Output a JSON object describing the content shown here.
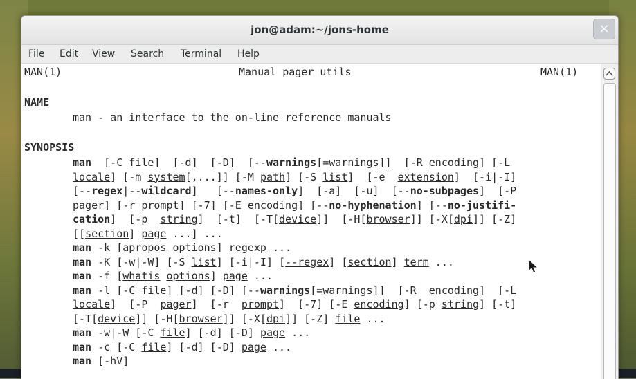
{
  "window": {
    "title": "jon@adam:~/jons-home",
    "close_glyph": "×"
  },
  "menu": [
    "File",
    "Edit",
    "View",
    "Search",
    "Terminal",
    "Help"
  ],
  "manpage": {
    "header_left": "MAN(1)",
    "header_center": "Manual pager utils",
    "header_right": "MAN(1)",
    "name_heading": "NAME",
    "name_desc": "man - an interface to the on-line reference manuals",
    "synopsis_heading": "SYNOPSIS",
    "synopsis_lines": [
      [
        {
          "t": "man",
          "b": 1
        },
        {
          "t": "  [-C "
        },
        {
          "t": "file",
          "u": 1
        },
        {
          "t": "]  [-d]  [-D]  [--"
        },
        {
          "t": "warnings",
          "b": 1
        },
        {
          "t": "[="
        },
        {
          "t": "warnings",
          "u": 1
        },
        {
          "t": "]]  [-R "
        },
        {
          "t": "encoding",
          "u": 1
        },
        {
          "t": "] [-L"
        }
      ],
      [
        {
          "t": "locale",
          "u": 1
        },
        {
          "t": "] [-m "
        },
        {
          "t": "system",
          "u": 1
        },
        {
          "t": "[,...]] [-M "
        },
        {
          "t": "path",
          "u": 1
        },
        {
          "t": "] [-S "
        },
        {
          "t": "list",
          "u": 1
        },
        {
          "t": "]  [-e  "
        },
        {
          "t": "extension",
          "u": 1
        },
        {
          "t": "]  [-i|-I]"
        }
      ],
      [
        {
          "t": "[--"
        },
        {
          "t": "regex",
          "b": 1
        },
        {
          "t": "|--"
        },
        {
          "t": "wildcard",
          "b": 1
        },
        {
          "t": "]   [--"
        },
        {
          "t": "names-only",
          "b": 1
        },
        {
          "t": "]  [-a]  [-u]  [--"
        },
        {
          "t": "no-subpages",
          "b": 1
        },
        {
          "t": "]  [-P"
        }
      ],
      [
        {
          "t": "pager",
          "u": 1
        },
        {
          "t": "] [-r "
        },
        {
          "t": "prompt",
          "u": 1
        },
        {
          "t": "] [-7] [-E "
        },
        {
          "t": "encoding",
          "u": 1
        },
        {
          "t": "] [--"
        },
        {
          "t": "no-hyphenation",
          "b": 1
        },
        {
          "t": "] [--"
        },
        {
          "t": "no-justifi-",
          "b": 1
        }
      ],
      [
        {
          "t": "cation",
          "b": 1
        },
        {
          "t": "]  [-p  "
        },
        {
          "t": "string",
          "u": 1
        },
        {
          "t": "]  [-t]  [-T["
        },
        {
          "t": "device",
          "u": 1
        },
        {
          "t": "]]  [-H["
        },
        {
          "t": "browser",
          "u": 1
        },
        {
          "t": "]] [-X["
        },
        {
          "t": "dpi",
          "u": 1
        },
        {
          "t": "]] [-Z]"
        }
      ],
      [
        {
          "t": "[["
        },
        {
          "t": "section",
          "u": 1
        },
        {
          "t": "] "
        },
        {
          "t": "page",
          "u": 1
        },
        {
          "t": " ...] ..."
        }
      ],
      [
        {
          "t": "man",
          "b": 1
        },
        {
          "t": " -k [",
          "b": 0
        },
        {
          "t": "apropos",
          "u": 1
        },
        {
          "t": " "
        },
        {
          "t": "options",
          "u": 1
        },
        {
          "t": "] "
        },
        {
          "t": "regexp",
          "u": 1
        },
        {
          "t": " ..."
        }
      ],
      [
        {
          "t": "man",
          "b": 1
        },
        {
          "t": " -K [-w|-W] [-S "
        },
        {
          "t": "list",
          "u": 1
        },
        {
          "t": "] [-i|-I] ["
        },
        {
          "t": "--regex",
          "u": 1
        },
        {
          "t": "] ["
        },
        {
          "t": "section",
          "u": 1
        },
        {
          "t": "] "
        },
        {
          "t": "term",
          "u": 1
        },
        {
          "t": " ..."
        }
      ],
      [
        {
          "t": "man",
          "b": 1
        },
        {
          "t": " -f ["
        },
        {
          "t": "whatis",
          "u": 1
        },
        {
          "t": " "
        },
        {
          "t": "options",
          "u": 1
        },
        {
          "t": "] "
        },
        {
          "t": "page",
          "u": 1
        },
        {
          "t": " ..."
        }
      ],
      [
        {
          "t": "man",
          "b": 1
        },
        {
          "t": " -l [-C "
        },
        {
          "t": "file",
          "u": 1
        },
        {
          "t": "] [-d] [-D] [--"
        },
        {
          "t": "warnings",
          "b": 1
        },
        {
          "t": "[="
        },
        {
          "t": "warnings",
          "u": 1
        },
        {
          "t": "]]  [-R  "
        },
        {
          "t": "encoding",
          "u": 1
        },
        {
          "t": "]  [-L"
        }
      ],
      [
        {
          "t": "locale",
          "u": 1
        },
        {
          "t": "]  [-P  "
        },
        {
          "t": "pager",
          "u": 1
        },
        {
          "t": "]  [-r  "
        },
        {
          "t": "prompt",
          "u": 1
        },
        {
          "t": "]  [-7] [-E "
        },
        {
          "t": "encoding",
          "u": 1
        },
        {
          "t": "] [-p "
        },
        {
          "t": "string",
          "u": 1
        },
        {
          "t": "] [-t]"
        }
      ],
      [
        {
          "t": "[-T["
        },
        {
          "t": "device",
          "u": 1
        },
        {
          "t": "]] [-H["
        },
        {
          "t": "browser",
          "u": 1
        },
        {
          "t": "]] [-X["
        },
        {
          "t": "dpi",
          "u": 1
        },
        {
          "t": "]] [-Z] "
        },
        {
          "t": "file",
          "u": 1
        },
        {
          "t": " ..."
        }
      ],
      [
        {
          "t": "man",
          "b": 1
        },
        {
          "t": " -w|-W [-C "
        },
        {
          "t": "file",
          "u": 1
        },
        {
          "t": "] [-d] [-D] "
        },
        {
          "t": "page",
          "u": 1
        },
        {
          "t": " ..."
        }
      ],
      [
        {
          "t": "man",
          "b": 1
        },
        {
          "t": " -c [-C "
        },
        {
          "t": "file",
          "u": 1
        },
        {
          "t": "] [-d] [-D] "
        },
        {
          "t": "page",
          "u": 1
        },
        {
          "t": " ..."
        }
      ],
      [
        {
          "t": "man",
          "b": 1
        },
        {
          "t": " [-hV]"
        }
      ]
    ]
  },
  "icons": {
    "close": "close-icon",
    "scroll_up": "chevron-up-icon",
    "pointer": "mouse-pointer-icon"
  }
}
